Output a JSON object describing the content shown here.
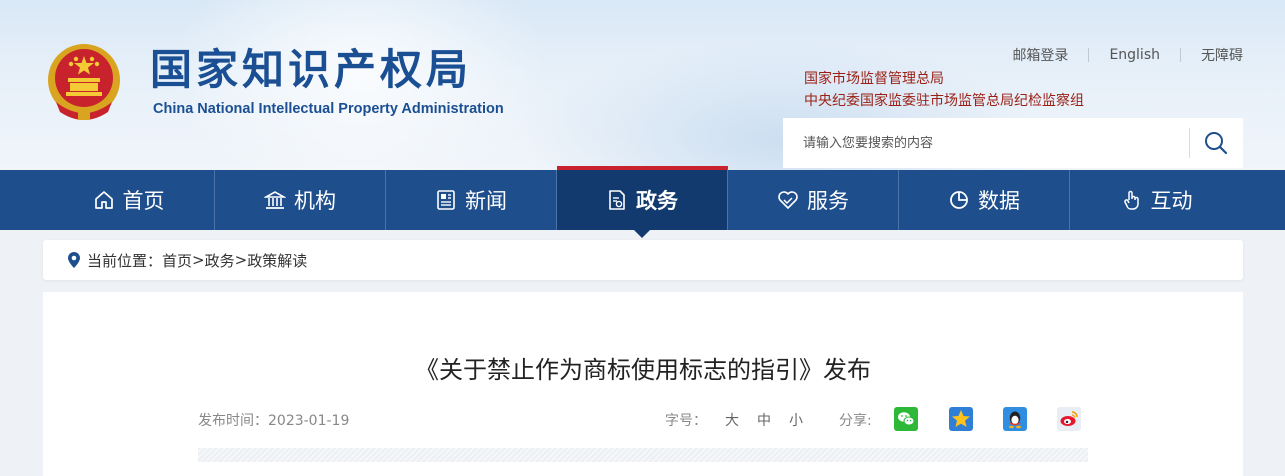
{
  "header": {
    "logo_cn": "国家知识产权局",
    "logo_en": "China National Intellectual Property Administration",
    "top_links": [
      "邮箱登录",
      "English",
      "无障碍"
    ],
    "agency_links": [
      "国家市场监督管理总局",
      "中央纪委国家监委驻市场监管总局纪检监察组"
    ],
    "search_placeholder": "请输入您要搜索的内容"
  },
  "nav": {
    "items": [
      {
        "label": "首页",
        "icon": "home-icon"
      },
      {
        "label": "机构",
        "icon": "institution-icon"
      },
      {
        "label": "新闻",
        "icon": "news-icon"
      },
      {
        "label": "政务",
        "icon": "government-affairs-icon"
      },
      {
        "label": "服务",
        "icon": "service-icon"
      },
      {
        "label": "数据",
        "icon": "data-icon"
      },
      {
        "label": "互动",
        "icon": "interaction-icon"
      }
    ],
    "active_index": 3
  },
  "breadcrumb": {
    "prefix": "当前位置：",
    "items": [
      "首页",
      "政务",
      "政策解读"
    ],
    "separator": ">"
  },
  "article": {
    "title": "《关于禁止作为商标使用标志的指引》发布",
    "publish_time": "发布时间：2023-01-19",
    "font_size_label": "字号：",
    "font_sizes": [
      "大",
      "中",
      "小"
    ],
    "share_label": "分享:",
    "share_targets": [
      "wechat-icon",
      "qzone-icon",
      "qq-icon",
      "weibo-icon"
    ]
  },
  "colors": {
    "nav_bg": "#1e4e8c",
    "nav_active_bg": "#123a6e",
    "accent_red": "#c8232c",
    "logo_blue": "#1b4f93",
    "agency_text": "#9a1f14"
  }
}
